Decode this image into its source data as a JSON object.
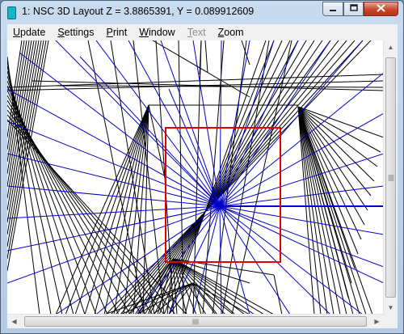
{
  "window": {
    "title": "1: NSC 3D Layout Z = 3.8865391, Y = 0.089912609",
    "caption": {
      "minimize_icon": "minimize-icon",
      "maximize_icon": "maximize-icon",
      "close_icon": "close-icon"
    }
  },
  "menu": [
    {
      "u": "U",
      "rest": "pdate",
      "enabled": true
    },
    {
      "u": "S",
      "rest": "ettings",
      "enabled": true
    },
    {
      "u": "P",
      "rest": "rint",
      "enabled": true
    },
    {
      "u": "W",
      "rest": "indow",
      "enabled": true
    },
    {
      "u": "T",
      "rest": "ext",
      "enabled": false
    },
    {
      "u": "Z",
      "rest": "oom",
      "enabled": true
    }
  ],
  "scrollbars": {
    "vertical": {
      "position": 0.5,
      "visible_fraction": 0.95
    },
    "horizontal": {
      "position": 0.5,
      "visible_fraction": 0.96
    }
  },
  "colors": {
    "black_rays": "#000000",
    "blue_rays": "#0000cc",
    "detector": "#e00000",
    "canvas": "#ffffff"
  }
}
